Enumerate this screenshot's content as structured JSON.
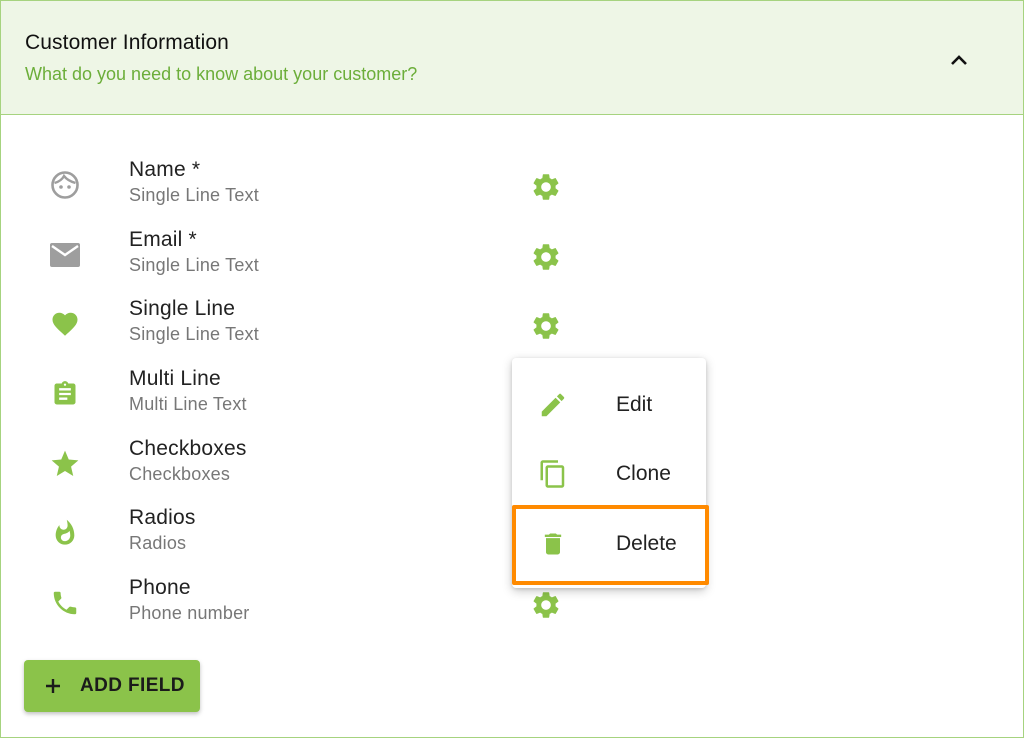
{
  "header": {
    "title": "Customer Information",
    "subtitle": "What do you need to know about your customer?",
    "collapse_icon": "chevron-up-icon"
  },
  "fields": [
    {
      "title": "Name *",
      "subtitle": "Single Line Text",
      "icon": "face-icon"
    },
    {
      "title": "Email *",
      "subtitle": "Single Line Text",
      "icon": "mail-icon"
    },
    {
      "title": "Single Line",
      "subtitle": "Single Line Text",
      "icon": "heart-icon"
    },
    {
      "title": "Multi Line",
      "subtitle": "Multi Line Text",
      "icon": "clipboard-icon"
    },
    {
      "title": "Checkboxes",
      "subtitle": "Checkboxes",
      "icon": "star-icon"
    },
    {
      "title": "Radios",
      "subtitle": "Radios",
      "icon": "flame-icon"
    },
    {
      "title": "Phone",
      "subtitle": "Phone number",
      "icon": "phone-icon"
    }
  ],
  "context_menu": {
    "items": [
      {
        "label": "Edit",
        "icon": "pencil-icon"
      },
      {
        "label": "Clone",
        "icon": "copy-icon"
      },
      {
        "label": "Delete",
        "icon": "trash-icon"
      }
    ],
    "highlighted": "Delete"
  },
  "add_field": {
    "label": "ADD FIELD",
    "icon": "plus-icon"
  },
  "colors": {
    "accent": "#8bc34a",
    "subtitle_green": "#6cae3a",
    "header_bg": "#eef6e6",
    "border": "#a6d37f",
    "highlight": "#ff8a00",
    "grey_icon": "#9e9e9e"
  }
}
